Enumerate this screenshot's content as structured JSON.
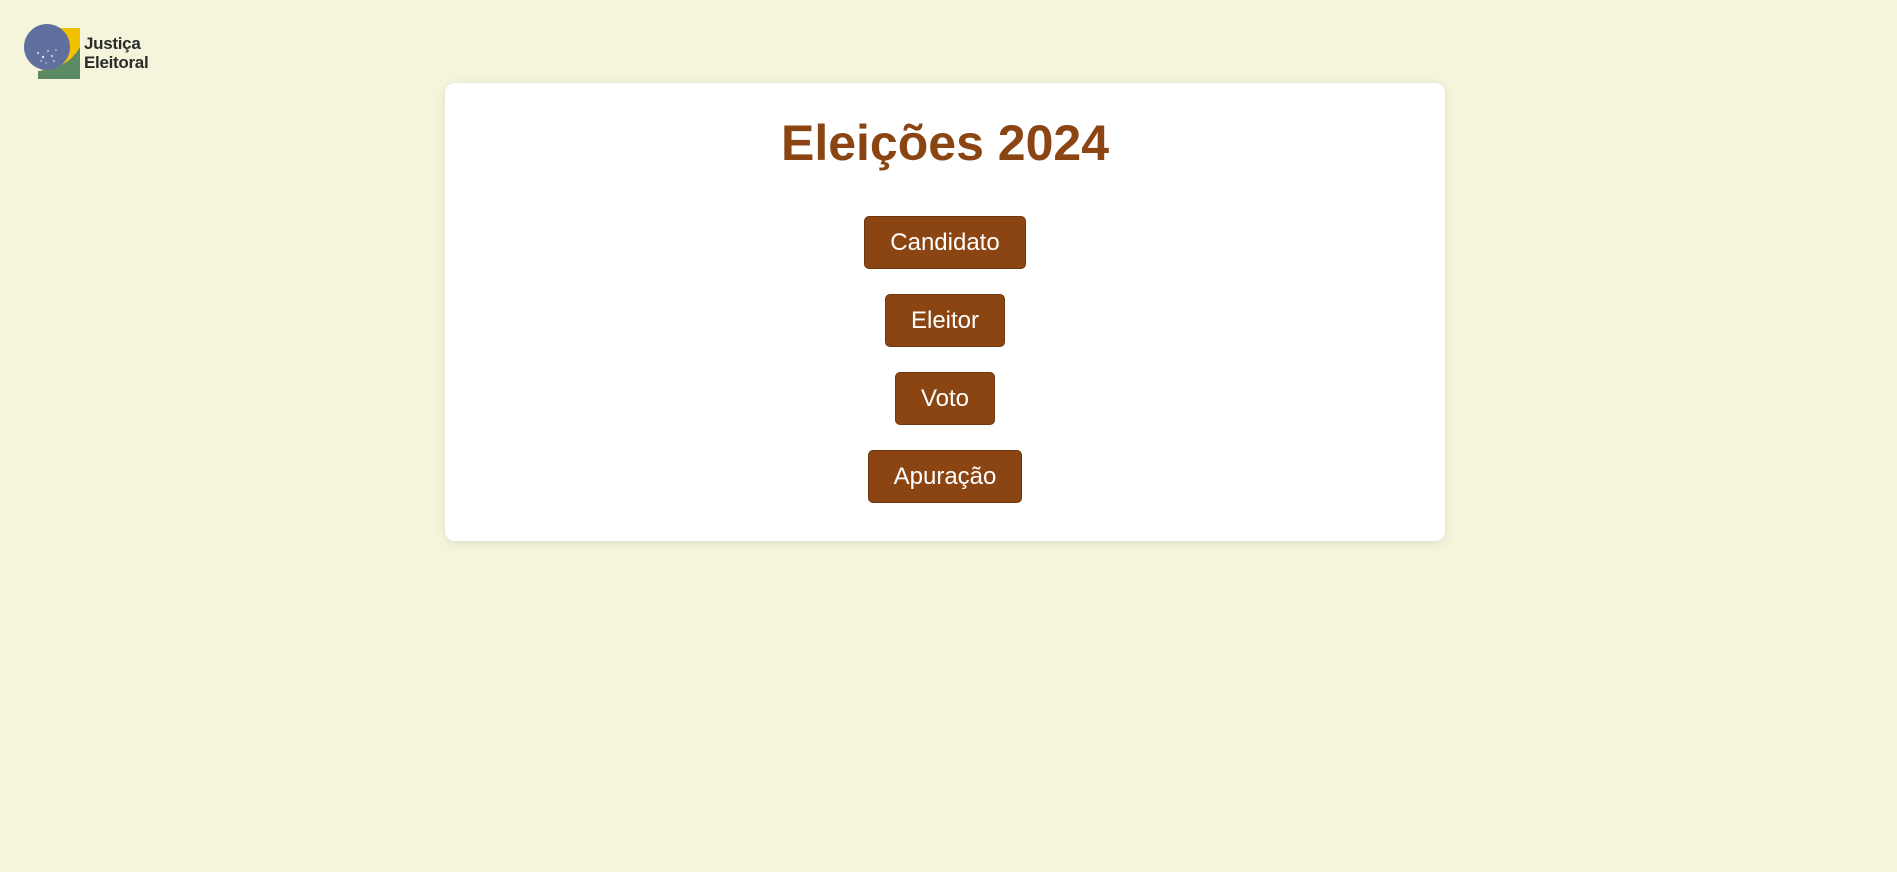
{
  "logo": {
    "line1": "Justiça",
    "line2": "Eleitoral",
    "icon": "justica-eleitoral-emblem"
  },
  "main": {
    "title": "Eleições 2024",
    "buttons": [
      {
        "label": "Candidato"
      },
      {
        "label": "Eleitor"
      },
      {
        "label": "Voto"
      },
      {
        "label": "Apuração"
      }
    ]
  },
  "colors": {
    "background": "#f5f5dc",
    "accent": "#8b4513",
    "card": "#ffffff"
  }
}
